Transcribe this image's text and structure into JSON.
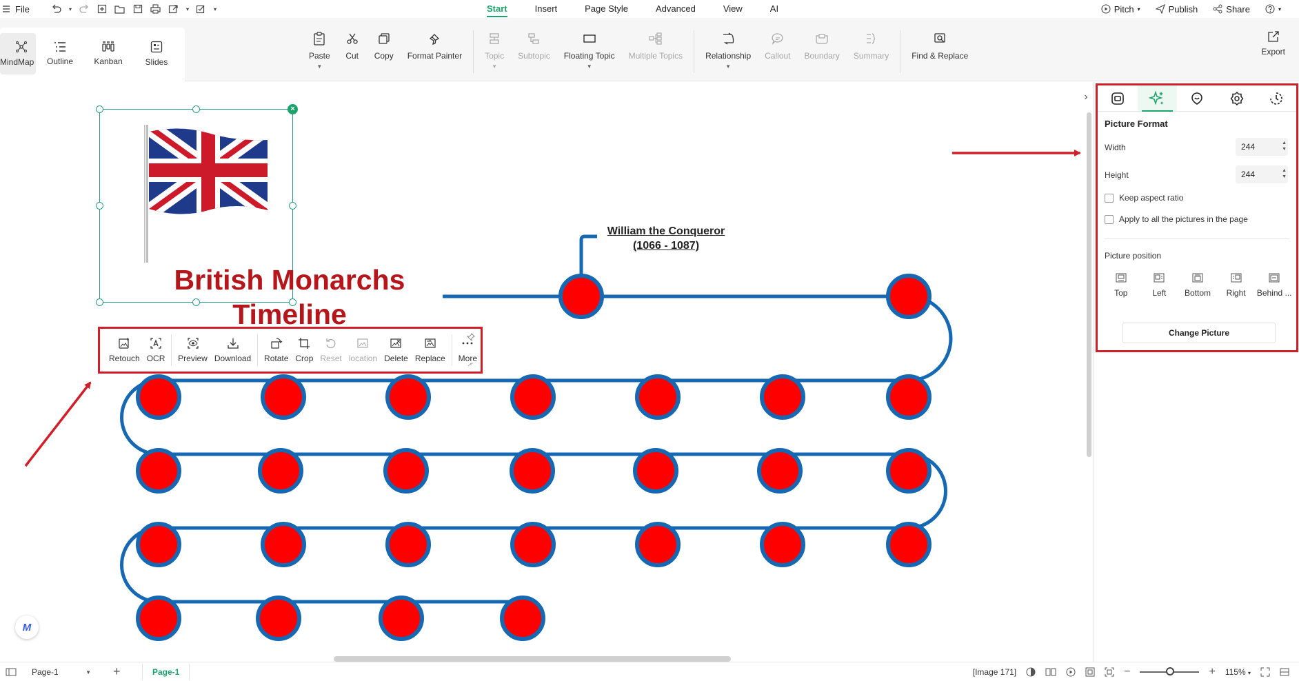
{
  "menubar": {
    "file": "File",
    "tabs": [
      {
        "label": "Start",
        "active": true
      },
      {
        "label": "Insert"
      },
      {
        "label": "Page Style"
      },
      {
        "label": "Advanced"
      },
      {
        "label": "View"
      },
      {
        "label": "AI"
      }
    ],
    "pitch": "Pitch",
    "publish": "Publish",
    "share": "Share"
  },
  "ribbon": {
    "views": [
      {
        "label": "MindMap",
        "active": true
      },
      {
        "label": "Outline"
      },
      {
        "label": "Kanban"
      },
      {
        "label": "Slides"
      }
    ],
    "tools": {
      "paste": "Paste",
      "cut": "Cut",
      "copy": "Copy",
      "format_painter": "Format Painter",
      "topic": "Topic",
      "subtopic": "Subtopic",
      "floating_topic": "Floating Topic",
      "multiple_topics": "Multiple Topics",
      "relationship": "Relationship",
      "callout": "Callout",
      "boundary": "Boundary",
      "summary": "Summary",
      "find_replace": "Find & Replace"
    },
    "export": "Export"
  },
  "canvas": {
    "title_line1": "British Monarchs",
    "title_line2": "Timeline",
    "node_label_line1": "William the Conqueror",
    "node_label_line2": "(1066 - 1087)",
    "timeline_colors": {
      "line": "#1668b3",
      "node_fill": "#ff0000",
      "node_stroke": "#1668b3"
    },
    "title_color": "#b4161b"
  },
  "picture_toolbar": {
    "retouch": "Retouch",
    "ocr": "OCR",
    "preview": "Preview",
    "download": "Download",
    "rotate": "Rotate",
    "crop": "Crop",
    "reset": "Reset",
    "location": "location",
    "delete": "Delete",
    "replace": "Replace",
    "more": "More"
  },
  "panel": {
    "title": "Picture Format",
    "width_label": "Width",
    "width_value": "244",
    "height_label": "Height",
    "height_value": "244",
    "keep_aspect": "Keep aspect ratio",
    "apply_all": "Apply to all the pictures in the page",
    "position_label": "Picture position",
    "positions": [
      "Top",
      "Left",
      "Bottom",
      "Right",
      "Behind ..."
    ],
    "change_picture": "Change Picture"
  },
  "statusbar": {
    "page_select": "Page-1",
    "page_tab": "Page-1",
    "image_info": "[Image 171]",
    "zoom": "115%"
  },
  "accent_color": "#1aa36b",
  "highlight_color": "#d11f2a"
}
